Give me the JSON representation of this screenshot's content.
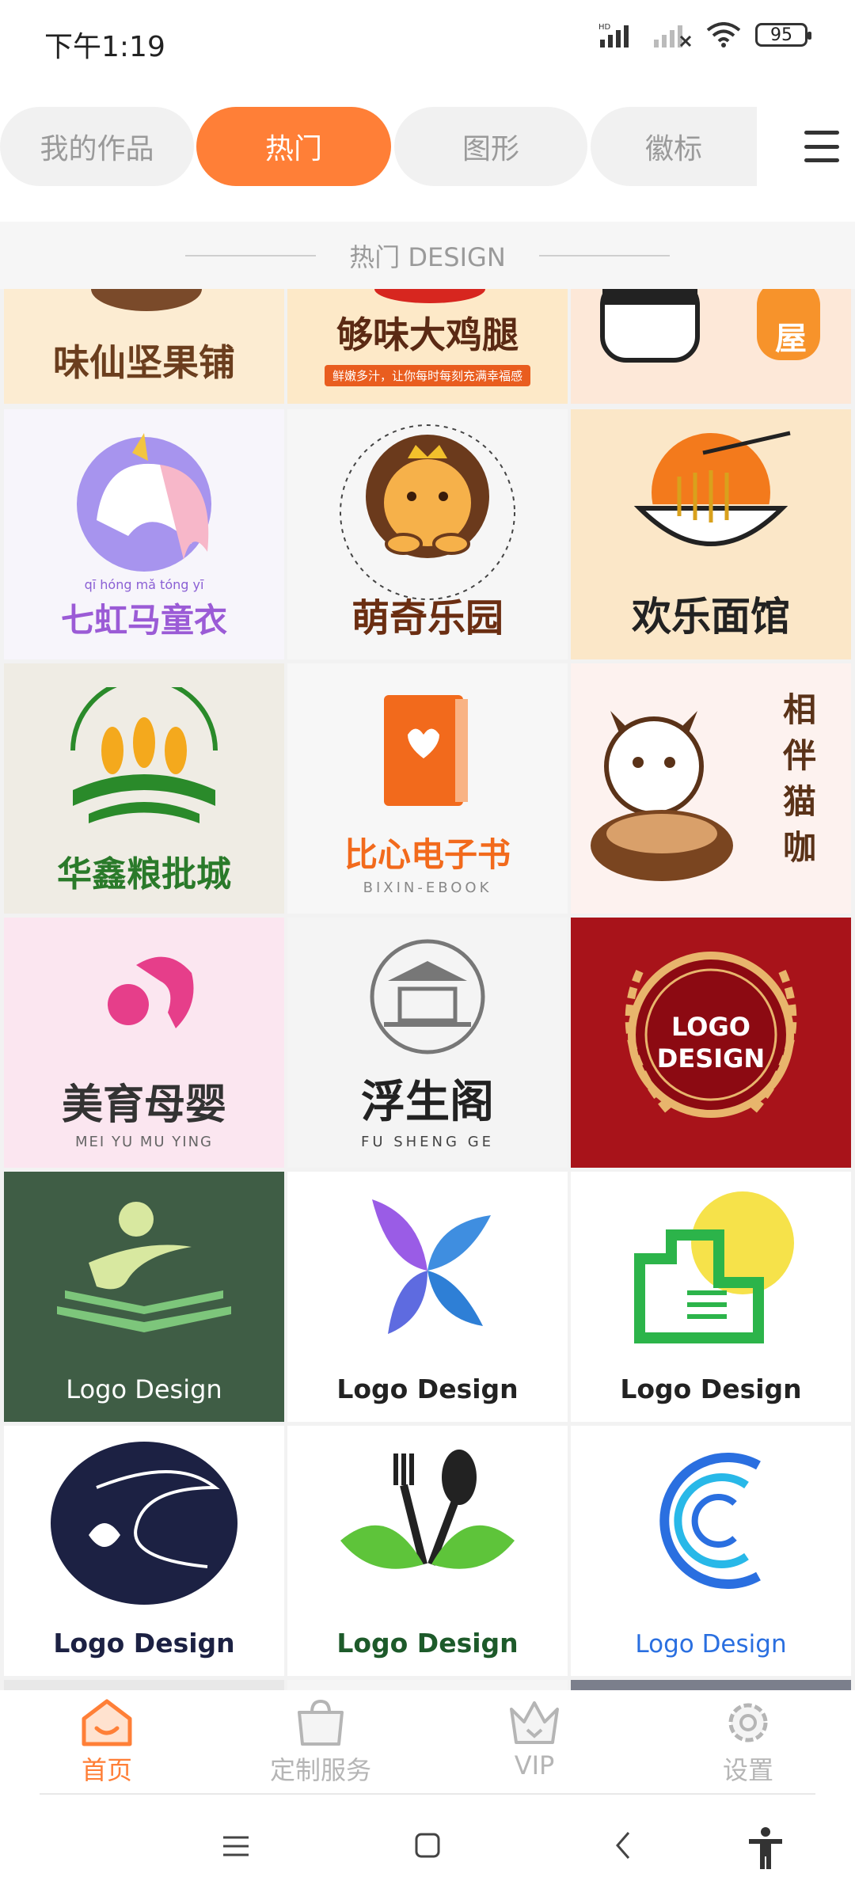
{
  "status": {
    "time": "下午1:19",
    "battery": "95"
  },
  "tabs": [
    {
      "label": "我的作品"
    },
    {
      "label": "热门"
    },
    {
      "label": "图形"
    },
    {
      "label": "徽标"
    }
  ],
  "section_title": "热门 DESIGN",
  "tiles": [
    {
      "title": "味仙坚果铺"
    },
    {
      "title": "够味大鸡腿",
      "sub": "鲜嫩多汁，让你每时每刻充满幸福感"
    },
    {
      "title": "屋"
    },
    {
      "title": "七虹马童衣",
      "pinyin": "qī hóng mǎ tóng yī"
    },
    {
      "title": "萌奇乐园"
    },
    {
      "title": "欢乐面馆"
    },
    {
      "title": "华鑫粮批城"
    },
    {
      "title": "比心电子书",
      "sub": "BIXIN-EBOOK"
    },
    {
      "title": "相伴猫咖"
    },
    {
      "title": "美育母婴",
      "sub": "MEI  YU  MU  YING"
    },
    {
      "title": "浮生阁",
      "sub": "FU  SHENG  GE"
    },
    {
      "title": "LOGO DESIGN"
    },
    {
      "title": "Logo Design"
    },
    {
      "title": "Logo Design"
    },
    {
      "title": "Logo Design"
    },
    {
      "title": "Logo Design"
    },
    {
      "title": "Logo Design"
    },
    {
      "title": "Logo Design"
    }
  ],
  "bottom_nav": [
    {
      "label": "首页"
    },
    {
      "label": "定制服务"
    },
    {
      "label": "VIP"
    },
    {
      "label": "设置"
    }
  ],
  "colors": {
    "accent": "#ff7f37",
    "inactive": "#b5b5b5"
  }
}
